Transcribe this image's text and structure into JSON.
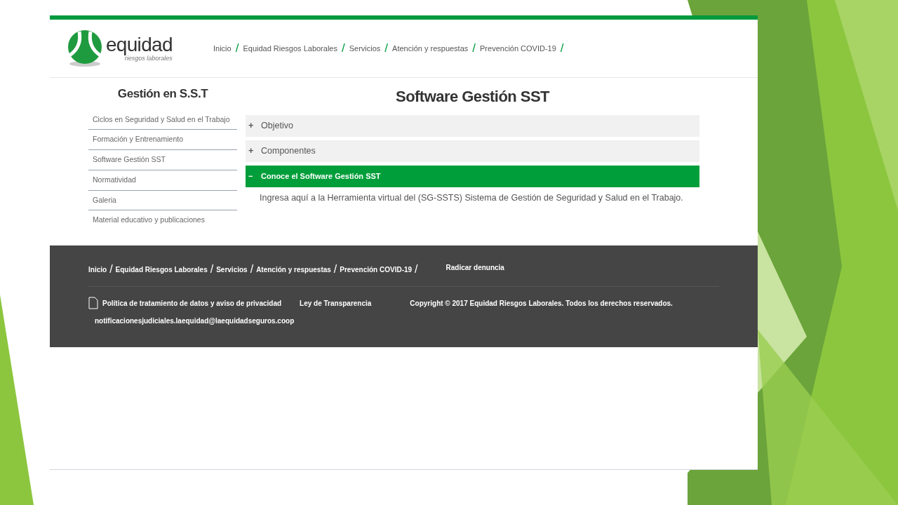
{
  "logo": {
    "name": "equidad",
    "tagline": "riesgos laborales"
  },
  "nav": [
    {
      "label": "Inicio",
      "sep": "/"
    },
    {
      "label": "Equidad Riesgos Laborales",
      "sep": "/"
    },
    {
      "label": "Servicios",
      "sep": "/"
    },
    {
      "label": "Atención y respuestas",
      "sep": "/"
    },
    {
      "label": "Prevención COVID-19",
      "sep": "/"
    }
  ],
  "sidebar": {
    "title": "Gestión en S.S.T",
    "items": [
      "Ciclos en Seguridad y Salud en el Trabajo",
      "Formación y Entrenamiento",
      "Software Gestión SST",
      "Normatividad",
      "Galeria",
      "Material educativo y publicaciones"
    ]
  },
  "main": {
    "title": "Software Gestión SST",
    "accordion": [
      {
        "label": "Objetivo",
        "toggle": "+",
        "expanded": false
      },
      {
        "label": "Componentes",
        "toggle": "+",
        "expanded": false
      },
      {
        "label": "Conoce el Software Gestión SST",
        "toggle": "−",
        "expanded": true,
        "body": "Ingresa aquí a la Herramienta virtual del (SG-SSTS) Sistema de Gestión de Seguridad y Salud en el Trabajo."
      }
    ]
  },
  "footer": {
    "nav": [
      {
        "label": "Inicio",
        "sep": "/"
      },
      {
        "label": "Equidad Riesgos Laborales",
        "sep": "/"
      },
      {
        "label": "Servicios",
        "sep": "/"
      },
      {
        "label": "Atención y respuestas",
        "sep": "/"
      },
      {
        "label": "Prevención COVID-19",
        "sep": "/"
      }
    ],
    "report_link": "Radicar denuncia",
    "privacy": "Política de tratamiento de datos y aviso de privacidad",
    "transparency": "Ley de Transparencia",
    "copyright": "Copyright © 2017 Equidad Riesgos Laborales. Todos los derechos reservados.",
    "email": "notificacionesjudiciales.laequidad@laequidadseguros.coop"
  }
}
